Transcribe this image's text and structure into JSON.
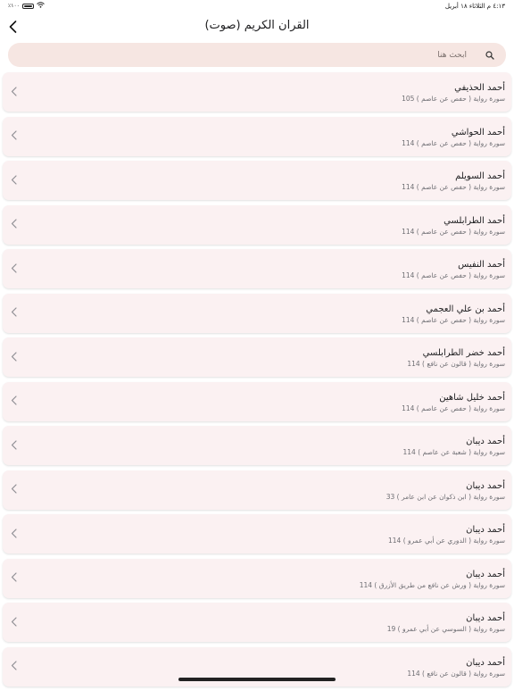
{
  "status_bar": {
    "time_date": "٤:١٣ م   الثلاثاء ١٨ أبريل",
    "battery": "١٠٠٪",
    "wifi_icon": "wifi-icon",
    "battery_icon": "battery-icon"
  },
  "header": {
    "title": "القران الكريم (صوت)",
    "back_icon": "chevron-left-icon"
  },
  "search": {
    "placeholder": "ابحث هنا",
    "icon": "search-icon"
  },
  "colors": {
    "search_bg": "#f6e6e2",
    "row_bg": "#fbf1f2"
  },
  "reciters": [
    {
      "name": "أحمد الحذيفي",
      "subtitle": "سورة رواية ( حفص عن عاصم ) 105"
    },
    {
      "name": "أحمد الحواشي",
      "subtitle": "سورة رواية ( حفص عن عاصم ) 114"
    },
    {
      "name": "أحمد السويلم",
      "subtitle": "سورة رواية ( حفص عن عاصم ) 114"
    },
    {
      "name": "أحمد الطرابلسي",
      "subtitle": "سورة رواية ( حفص عن عاصم ) 114"
    },
    {
      "name": "أحمد النفيس",
      "subtitle": "سورة رواية ( حفص عن عاصم ) 114"
    },
    {
      "name": "أحمد بن علي العجمي",
      "subtitle": "سورة رواية ( حفص عن عاصم ) 114"
    },
    {
      "name": "أحمد خضر الطرابلسي",
      "subtitle": "سورة رواية ( قالون عن نافع ) 114"
    },
    {
      "name": "أحمد خليل شاهين",
      "subtitle": "سورة رواية ( حفص عن عاصم ) 114"
    },
    {
      "name": "أحمد ديبان",
      "subtitle": "سورة رواية ( شعبة عن عاصم ) 114"
    },
    {
      "name": "أحمد ديبان",
      "subtitle": "سورة رواية ( ابن ذكوان عن ابن عامر ) 33"
    },
    {
      "name": "أحمد ديبان",
      "subtitle": "سورة رواية ( الدوري عن أبي عمرو ) 114"
    },
    {
      "name": "أحمد ديبان",
      "subtitle": "سورة رواية ( ورش عن نافع من طريق الأزرق ) 114"
    },
    {
      "name": "أحمد ديبان",
      "subtitle": "سورة رواية ( السوسي عن أبي عمرو ) 19"
    },
    {
      "name": "أحمد ديبان",
      "subtitle": "سورة رواية ( قالون عن نافع ) 114"
    }
  ]
}
